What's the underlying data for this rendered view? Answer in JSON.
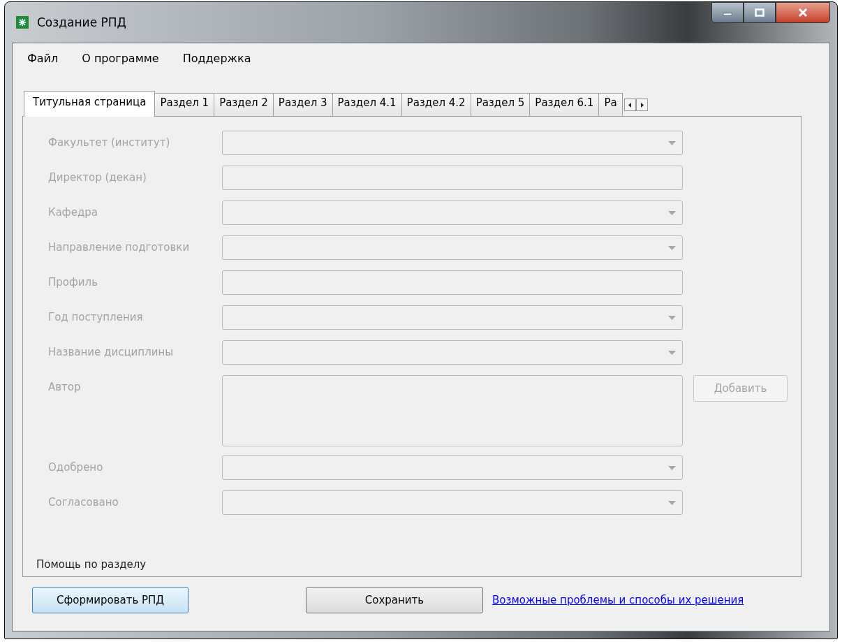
{
  "window": {
    "title": "Создание РПД"
  },
  "menu": [
    "Файл",
    "О программе",
    "Поддержка"
  ],
  "tabs": [
    {
      "label": "Титульная страница",
      "selected": true
    },
    {
      "label": "Раздел 1",
      "selected": false
    },
    {
      "label": "Раздел 2",
      "selected": false
    },
    {
      "label": "Раздел 3",
      "selected": false
    },
    {
      "label": "Раздел 4.1",
      "selected": false
    },
    {
      "label": "Раздел 4.2",
      "selected": false
    },
    {
      "label": "Раздел 5",
      "selected": false
    },
    {
      "label": "Раздел 6.1",
      "selected": false
    },
    {
      "label": "Ра",
      "selected": false
    }
  ],
  "fields": [
    {
      "label": "Факультет (институт)",
      "kind": "combo",
      "disabled": true
    },
    {
      "label": "Директор (декан)",
      "kind": "text",
      "disabled": true
    },
    {
      "label": "Кафедра",
      "kind": "combo",
      "disabled": true
    },
    {
      "label": "Направление подготовки",
      "kind": "combo",
      "disabled": true
    },
    {
      "label": "Профиль",
      "kind": "text",
      "disabled": true
    },
    {
      "label": "Год поступления",
      "kind": "combo",
      "disabled": true
    },
    {
      "label": "Название дисциплины",
      "kind": "combo",
      "disabled": true
    },
    {
      "label": "Автор",
      "kind": "list",
      "disabled": true,
      "button": {
        "label": "Добавить",
        "disabled": true
      }
    },
    {
      "label": "Одобрено",
      "kind": "combo",
      "disabled": true
    },
    {
      "label": "Согласовано",
      "kind": "combo",
      "disabled": true
    }
  ],
  "help": "Помощь по разделу",
  "buttons": {
    "generate": "Сформировать РПД",
    "save": "Сохранить"
  },
  "link": "Возможные проблемы и способы их решения"
}
